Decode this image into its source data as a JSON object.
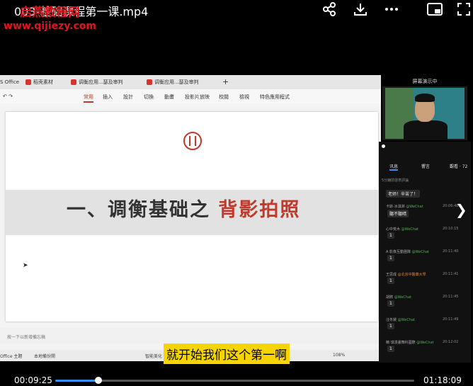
{
  "player": {
    "file_title": "003-基础课程第一课.mp4",
    "watermark_text": "启燕教程网",
    "watermark_url": "www.qijiezy.com",
    "icons": [
      "share-icon",
      "download-icon",
      "more-icon",
      "picture-in-picture-icon",
      "fullscreen-icon"
    ],
    "time_current": "00:09:25",
    "time_total": "01:18:09",
    "progress": 0.12,
    "subtitle": "就开始我们这个第一啊"
  },
  "app": {
    "tabs": [
      "S Office",
      "稻壳素材",
      "调衡应用...瑟及审判",
      "调衡应用...瑟及审判"
    ],
    "ribbon": [
      "常用",
      "插入",
      "設計",
      "切換",
      "動畫",
      "投影片放映",
      "校閱",
      "檢視",
      "特色應用程式"
    ],
    "slide_title_main": "一、调衡基础之",
    "slide_title_accent": "背影拍照",
    "notes_placeholder": "按一下以新增備忘稿",
    "status": [
      "Office 主題",
      "本地備份開",
      "智能美化",
      "108%"
    ]
  },
  "webcam": {
    "label": "屏幕演示中"
  },
  "chat": {
    "tabs": [
      "讯息",
      "響言",
      "觀看 · 72"
    ],
    "count_label": "5分鐘前發表評論",
    "messages": [
      {
        "name": "老师！辛苦了！",
        "source": "",
        "time": "",
        "text": ""
      },
      {
        "name": "卡斯·冰淇淋",
        "source": "@WeChat",
        "time": "20:06:48",
        "text": "聽不聽晴"
      },
      {
        "name": "心中荒木",
        "source": "@WeChat",
        "time": "20:10:15",
        "text": "1"
      },
      {
        "name": "A 影像互動團隊",
        "source": "@WeChat",
        "time": "20:11:40",
        "text": "1"
      },
      {
        "name": "王思成",
        "source": "@北京中醫藥大學",
        "time": "20:11:41",
        "text": "1"
      },
      {
        "name": "胡騁",
        "source": "@WeChat",
        "time": "20:11:45",
        "text": "1"
      },
      {
        "name": "汪冬媛",
        "source": "@WeChat",
        "time": "20:11:49",
        "text": "1"
      },
      {
        "name": "精 琪漫畫舞科國際",
        "source": "@WeChat",
        "time": "20:12:02",
        "text": "1"
      }
    ]
  }
}
